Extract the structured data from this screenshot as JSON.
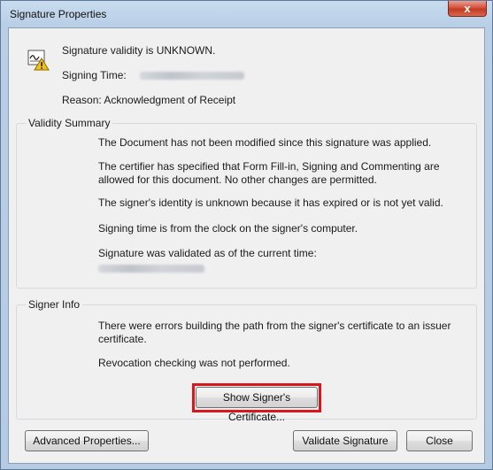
{
  "window": {
    "title": "Signature Properties",
    "close_glyph": "x"
  },
  "header": {
    "icon": "signature-warning-icon",
    "validity": "Signature validity is UNKNOWN.",
    "signing_time_label": "Signing Time:",
    "reason": "Reason:  Acknowledgment of Receipt"
  },
  "validity_summary": {
    "label": "Validity Summary",
    "lines": [
      "The Document has not been modified since this signature was applied.",
      "The certifier has specified that Form Fill-in, Signing and Commenting are allowed for this document. No other changes are permitted.",
      "The signer's identity is unknown because it has expired or is not yet valid.",
      "Signing time is from the clock on the signer's computer.",
      "Signature was validated as of the current time:"
    ]
  },
  "signer_info": {
    "label": "Signer Info",
    "lines": [
      "There were errors building the path from the signer's certificate to an issuer certificate.",
      "Revocation checking was not performed."
    ],
    "show_certificate_button": "Show Signer's Certificate..."
  },
  "footer": {
    "advanced_button": "Advanced Properties...",
    "validate_button": "Validate Signature",
    "close_button": "Close"
  },
  "colors": {
    "highlight": "#d8161c",
    "titlebar": "#b9cfe6",
    "client": "#f0f0f0"
  }
}
